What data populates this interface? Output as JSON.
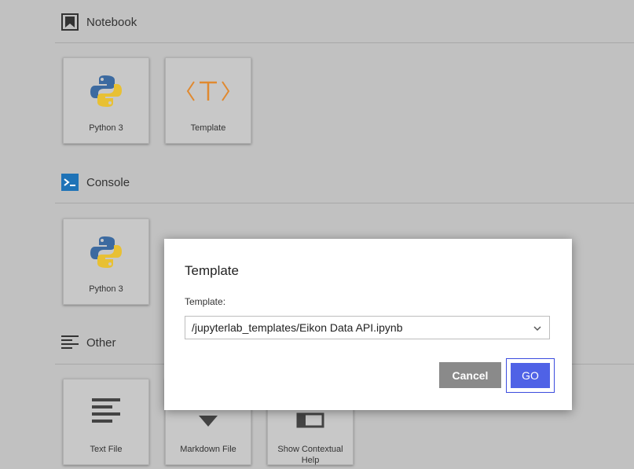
{
  "sections": {
    "notebook": {
      "title": "Notebook",
      "cards": [
        {
          "label": "Python 3",
          "icon": "python-logo-icon"
        },
        {
          "label": "Template",
          "icon": "template-icon"
        }
      ]
    },
    "console": {
      "title": "Console",
      "cards": [
        {
          "label": "Python 3",
          "icon": "python-logo-icon"
        }
      ]
    },
    "other": {
      "title": "Other",
      "cards": [
        {
          "label": "Text File",
          "icon": "text-file-icon"
        },
        {
          "label": "Markdown File",
          "icon": "markdown-file-icon"
        },
        {
          "label": "Show Contextual Help",
          "icon": "contextual-help-icon"
        }
      ]
    }
  },
  "dialog": {
    "title": "Template",
    "field_label": "Template:",
    "selected_value": "/jupyterlab_templates/Eikon Data API.ipynb",
    "cancel_label": "Cancel",
    "go_label": "GO"
  },
  "colors": {
    "backdrop": "#c1c1c1",
    "console_accent": "#1f73b7",
    "template_accent": "#e0892f",
    "go_button": "#4f62e6",
    "cancel_button": "#8a8a8a"
  }
}
